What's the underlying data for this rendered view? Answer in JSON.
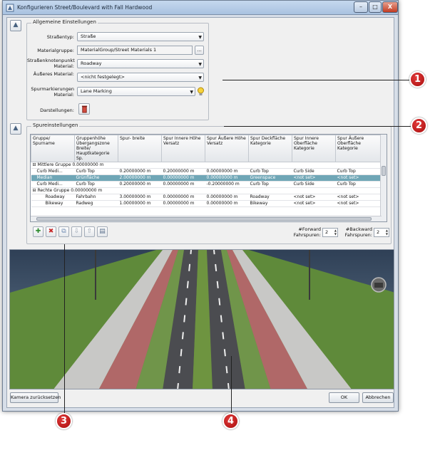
{
  "window": {
    "title": "Konfigurieren Street/Boulevard with Fall Hardwood",
    "min_label": "–",
    "max_label": "□",
    "close_label": "X"
  },
  "general": {
    "group_title": "Allgemeine Einstellungen",
    "strassentyp_label": "Straßentyp:",
    "strassentyp_value": "Straße",
    "materialgruppe_label": "Materialgruppe:",
    "materialgruppe_value": "MaterialGroup/Street Materials 1",
    "browse_label": "...",
    "knotenpunkt_label": "Straßenknotenpunkt Material:",
    "knotenpunkt_value": "Roadway",
    "aeusseres_label": "Äußeres Material:",
    "aeusseres_value": "<nicht festgelegt>",
    "spurmarkierung_label": "Spurmarkierungen Material:",
    "spurmarkierung_value": "Lane Marking",
    "darstellungen_label": "Darstellungen:"
  },
  "lanes": {
    "group_title": "Spureinstellungen",
    "columns": [
      "Gruppe/ Spurname",
      "Gruppenhöhe Übergangszone Breite/ Hauptkategorie Sp.",
      "Spur- breite",
      "Spur Innere Höhe Versatz",
      "Spur Äußere Höhe Versatz",
      "Spur Deckfläche Kategorie",
      "Spur Innere Oberfläche Kategorie",
      "Spur Äußere Oberfläche Kategorie"
    ],
    "groups": [
      {
        "name": "Mittlere Gruppe",
        "height": "0.00000000 m"
      },
      {
        "name": "Rechte Gruppe",
        "height": "0.00000000 m"
      }
    ],
    "rows_middle": [
      [
        "Curb Medi...",
        "Curb Top",
        "0.20000000 m",
        "0.20000000 m",
        "0.00000000 m",
        "Curb Top",
        "Curb Side",
        "Curb Top"
      ],
      [
        "Median",
        "Grünfläche",
        "2.00000000 m",
        "0.00000000 m",
        "0.00000000 m",
        "Greenspace",
        "<not set>",
        "<not set>"
      ],
      [
        "Curb Medi...",
        "Curb Top",
        "0.20000000 m",
        "0.00000000 m",
        "-0.20000000 m",
        "Curb Top",
        "Curb Side",
        "Curb Top"
      ]
    ],
    "rows_right": [
      [
        "Roadway",
        "Fahrbahn",
        "3.00000000 m",
        "0.00000000 m",
        "0.00000000 m",
        "Roadway",
        "<not set>",
        "<not set>"
      ],
      [
        "Bikeway",
        "Radweg",
        "1.00000000 m",
        "0.00000000 m",
        "0.00000000 m",
        "Bikeway",
        "<not set>",
        "<not set>"
      ]
    ],
    "forward_label": "#Forward Fahrspuren:",
    "forward_value": "2",
    "backward_label": "#Backward Fahrspuren:",
    "backward_value": "2"
  },
  "footer": {
    "reset_camera": "Kamera zurücksetzen",
    "ok": "OK",
    "cancel": "Abbrechen"
  },
  "callouts": [
    "1",
    "2",
    "3",
    "4"
  ]
}
